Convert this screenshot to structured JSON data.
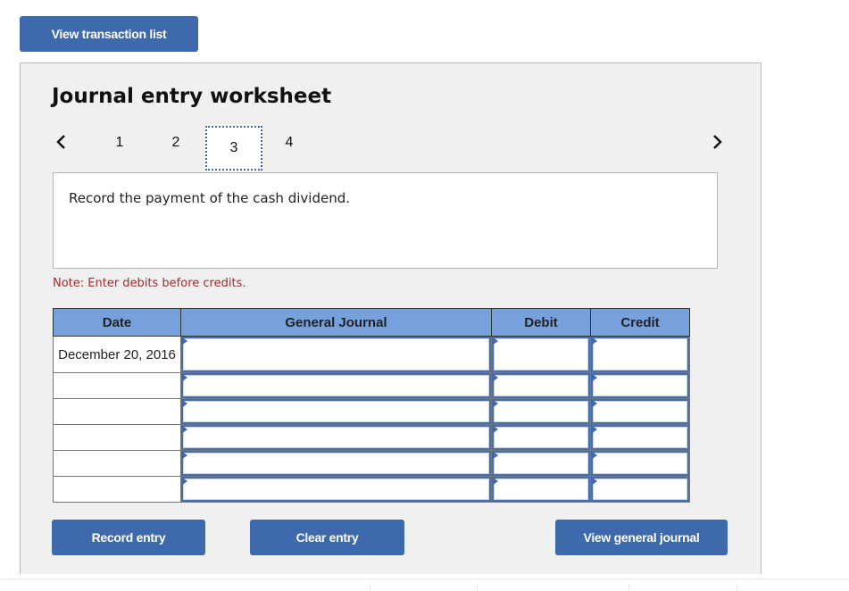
{
  "top_button": "View transaction list",
  "worksheet": {
    "title": "Journal entry worksheet",
    "pages": [
      "1",
      "2",
      "3",
      "4"
    ],
    "active_page": "3",
    "prompt": "Record the payment of the cash dividend.",
    "note": "Note: Enter debits before credits."
  },
  "table": {
    "headers": [
      "Date",
      "General Journal",
      "Debit",
      "Credit"
    ],
    "rows": [
      {
        "date": "December 20, 2016",
        "account": "",
        "debit": "",
        "credit": ""
      },
      {
        "date": "",
        "account": "",
        "debit": "",
        "credit": ""
      },
      {
        "date": "",
        "account": "",
        "debit": "",
        "credit": ""
      },
      {
        "date": "",
        "account": "",
        "debit": "",
        "credit": ""
      },
      {
        "date": "",
        "account": "",
        "debit": "",
        "credit": ""
      },
      {
        "date": "",
        "account": "",
        "debit": "",
        "credit": ""
      }
    ]
  },
  "buttons": {
    "record": "Record entry",
    "clear": "Clear entry",
    "view_journal": "View general journal"
  },
  "colors": {
    "button": "#3e69ad",
    "header": "#76a1dd",
    "note": "#a52a2a"
  }
}
